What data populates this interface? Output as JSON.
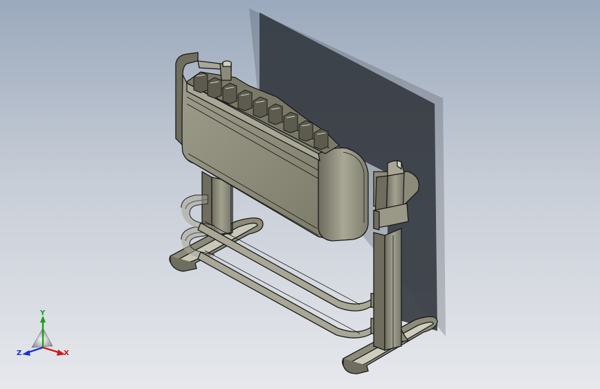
{
  "triad": {
    "x_label": "X",
    "y_label": "Y",
    "z_label": "Z",
    "x_color": "#d01818",
    "y_color": "#18a018",
    "z_color": "#1c2fd0"
  },
  "colors": {
    "part_fill": "#8b8a78",
    "part_dark": "#6f6e5e",
    "part_light": "#b6b5a6",
    "edge": "#1a1a1a",
    "shadow": "#3a4048"
  }
}
